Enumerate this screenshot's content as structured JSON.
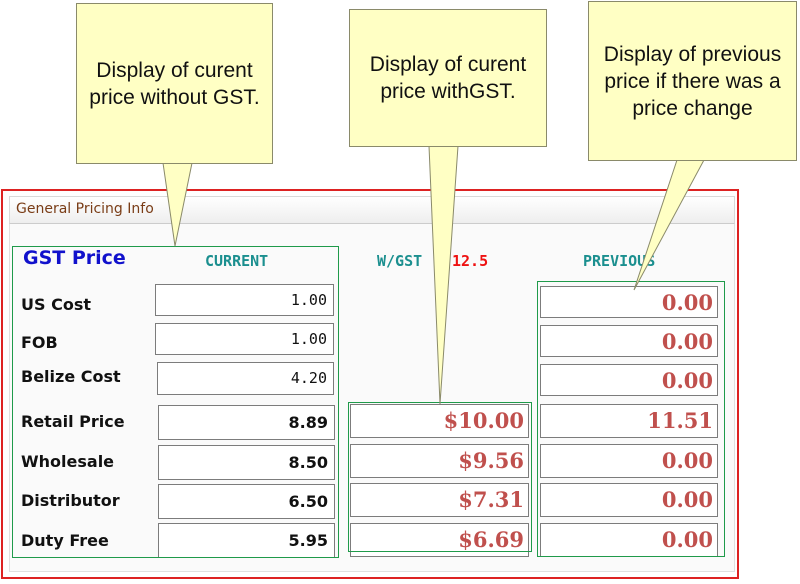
{
  "callouts": {
    "current_without_gst": "Display of curent price without GST.",
    "current_with_gst": "Display of curent price withGST.",
    "previous_price": "Display of previous price if there was a price change"
  },
  "panel": {
    "title": "General Pricing Info",
    "gst_price_label": "GST Price",
    "column_current": "CURRENT",
    "column_with_gst": "W/GST",
    "gst_rate": "12.5",
    "column_previous": "PREVIOUS"
  },
  "rows": [
    {
      "label": "US Cost",
      "current": "1.00",
      "previous": "0.00"
    },
    {
      "label": "FOB",
      "current": "1.00",
      "previous": "0.00"
    },
    {
      "label": "Belize Cost",
      "current": "4.20",
      "previous": "0.00"
    },
    {
      "label": "Retail Price",
      "current": "8.89",
      "with_gst": "$10.00",
      "previous": "11.51"
    },
    {
      "label": "Wholesale",
      "current": "8.50",
      "with_gst": "$9.56",
      "previous": "0.00"
    },
    {
      "label": "Distributor",
      "current": "6.50",
      "with_gst": "$7.31",
      "previous": "0.00"
    },
    {
      "label": "Duty Free",
      "current": "5.95",
      "with_gst": "$6.69",
      "previous": "0.00"
    }
  ],
  "colors": {
    "panel_border": "#dd2222",
    "title_text": "#7a3d17",
    "gst_price_label": "#1111cc",
    "column_headers": "#1b8f8f",
    "gst_rate": "#ee1111",
    "price_values": "#c0504d",
    "highlight_boxes": "#1f9a4a",
    "callout_fill": "#ffffc4"
  }
}
